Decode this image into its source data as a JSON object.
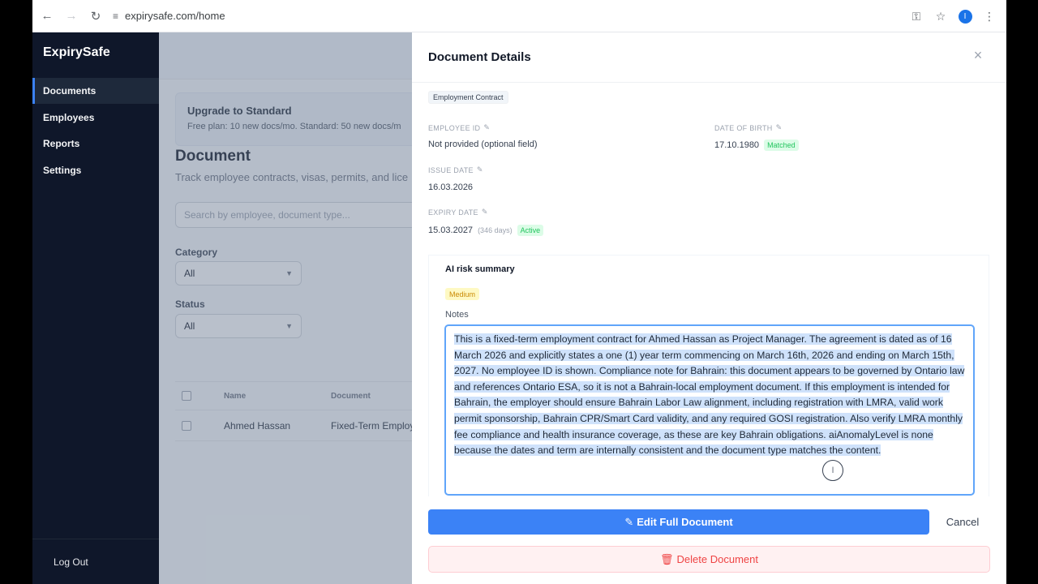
{
  "browser": {
    "url": "expirysafe.com/home",
    "profile_initial": "I"
  },
  "sidebar": {
    "brand": "ExpirySafe",
    "items": [
      {
        "label": "Documents"
      },
      {
        "label": "Employees"
      },
      {
        "label": "Reports"
      },
      {
        "label": "Settings"
      }
    ],
    "logout": "Log Out"
  },
  "main": {
    "upgrade_title": "Upgrade to Standard",
    "upgrade_sub": "Free plan: 10 new docs/mo. Standard: 50 new docs/m",
    "title": "Document",
    "subtitle": "Track employee contracts, visas, permits, and lice",
    "search_placeholder": "Search by employee, document type...",
    "category_label": "Category",
    "category_value": "All",
    "status_label": "Status",
    "status_value": "All",
    "table": {
      "headers": [
        "Name",
        "Document"
      ],
      "rows": [
        {
          "name": "Ahmed Hassan",
          "document": "Fixed-Term Employ"
        }
      ]
    }
  },
  "panel": {
    "title": "Document Details",
    "doc_type_tag": "Employment Contract",
    "employee_id": {
      "label": "EMPLOYEE ID",
      "value": "Not provided (optional field)"
    },
    "date_of_birth": {
      "label": "DATE OF BIRTH",
      "value": "17.10.1980",
      "badge": "Matched"
    },
    "issue_date": {
      "label": "ISSUE DATE",
      "value": "16.03.2026"
    },
    "expiry_date": {
      "label": "EXPIRY DATE",
      "value": "15.03.2027",
      "days": "(346 days)",
      "badge": "Active"
    },
    "risk_title": "AI risk summary",
    "risk_level": "Medium",
    "notes_label": "Notes",
    "notes_text": "This is a fixed-term employment contract for Ahmed Hassan as Project Manager. The agreement is dated as of 16 March 2026 and explicitly states a one (1) year term commencing on March 16th, 2026 and ending on March 15th, 2027. No employee ID is shown. Compliance note for Bahrain: this document appears to be governed by Ontario law and references Ontario ESA, so it is not a Bahrain-local employment document. If this employment is intended for Bahrain, the employer should ensure Bahrain Labor Law alignment, including registration with LMRA, valid work permit sponsorship, Bahrain CPR/Smart Card validity, and any required GOSI registration. Also verify LMRA monthly fee compliance and health insurance coverage, as these are key Bahrain obligations. aiAnomalyLevel is none because the dates and term are internally consistent and the document type matches the content.",
    "edit_button": "Edit Full Document",
    "cancel_button": "Cancel",
    "delete_button": "Delete Document"
  },
  "colors": {
    "sidebar_bg": "#0f172a",
    "accent": "#3b82f6",
    "danger": "#ef4444",
    "success": "#22c55e",
    "warning": "#ca8a04"
  }
}
